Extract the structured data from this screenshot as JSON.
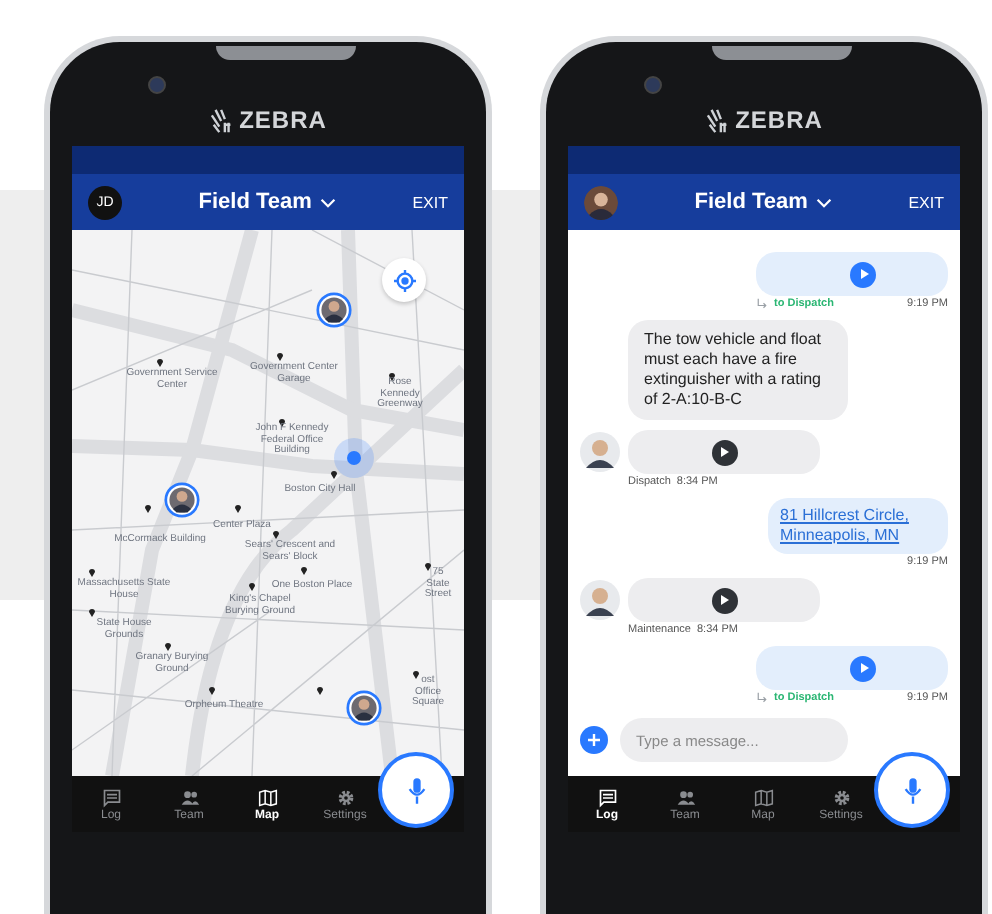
{
  "phones": [
    {
      "brand": "ZEBRA",
      "header": {
        "avatar": {
          "kind": "initials",
          "text": "JD"
        },
        "title": "Field Team",
        "action": "EXIT"
      },
      "screen": {
        "kind": "map",
        "labels": [
          {
            "text": "Government Service Center"
          },
          {
            "text": "Government Center Garage"
          },
          {
            "text": "Rose Kennedy Greenway"
          },
          {
            "text": "John F Kennedy Federal Office Building"
          },
          {
            "text": "Boston City Hall"
          },
          {
            "text": "Center Plaza"
          },
          {
            "text": "McCormack Building"
          },
          {
            "text": "Sears' Crescent and Sears' Block"
          },
          {
            "text": "Massachusetts State House"
          },
          {
            "text": "One Boston Place"
          },
          {
            "text": "75 State Street"
          },
          {
            "text": "King's Chapel Burying Ground"
          },
          {
            "text": "State House Grounds"
          },
          {
            "text": "Granary Burying Ground"
          },
          {
            "text": "Orpheum Theatre"
          },
          {
            "text": "ost Office Square"
          }
        ]
      },
      "nav": [
        {
          "label": "Log",
          "selected": false
        },
        {
          "label": "Team",
          "selected": false
        },
        {
          "label": "Map",
          "selected": true
        },
        {
          "label": "Settings",
          "selected": false
        }
      ]
    },
    {
      "brand": "ZEBRA",
      "header": {
        "avatar": {
          "kind": "photo"
        },
        "title": "Field Team",
        "action": "EXIT"
      },
      "screen": {
        "kind": "chat",
        "messages": [
          {
            "kind": "audio",
            "outgoing": true,
            "recipient": "to Dispatch",
            "time": "9:19 PM"
          },
          {
            "kind": "text",
            "outgoing": false,
            "text": "The tow vehicle and float must each have a fire extinguisher with a rating of 2-A:10-B-C"
          },
          {
            "kind": "audio",
            "outgoing": false,
            "sender": "Dispatch",
            "time": "8:34 PM"
          },
          {
            "kind": "link",
            "outgoing": true,
            "text": "81 Hillcrest Circle, Minneapolis, MN",
            "time": "9:19 PM"
          },
          {
            "kind": "audio",
            "outgoing": false,
            "sender": "Maintenance",
            "time": "8:34 PM"
          },
          {
            "kind": "audio",
            "outgoing": true,
            "recipient": "to Dispatch",
            "time": "9:19 PM"
          }
        ],
        "composer": {
          "placeholder": "Type a message..."
        }
      },
      "nav": [
        {
          "label": "Log",
          "selected": true
        },
        {
          "label": "Team",
          "selected": false
        },
        {
          "label": "Map",
          "selected": false
        },
        {
          "label": "Settings",
          "selected": false
        }
      ]
    }
  ]
}
